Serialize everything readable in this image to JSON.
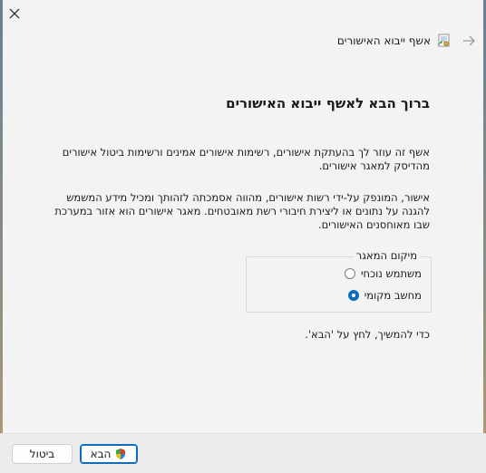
{
  "window": {
    "title": "אשף ייבוא האישורים"
  },
  "page": {
    "heading": "ברוך הבא לאשף ייבוא האישורים",
    "paragraph1": "אשף זה עוזר לך בהעתקת אישורים, רשימות אישורים אמינים ורשימות ביטול אישורים מהדיסק למאגר אישורים.",
    "paragraph2": "אישור, המונפק על-ידי רשות אישורים, מהווה אסמכתה לזהותך ומכיל מידע המשמש להגנה על נתונים או ליצירת חיבורי רשת מאובטחים. מאגר אישורים הוא אזור במערכת שבו מאוחסנים האישורים.",
    "store_location": {
      "legend": "מיקום המאגר",
      "options": [
        {
          "label": "משתמש נוכחי",
          "selected": false
        },
        {
          "label": "מחשב מקומי",
          "selected": true
        }
      ]
    },
    "continue_text": "כדי להמשיך, לחץ על 'הבא'."
  },
  "footer": {
    "next_label": "הבא",
    "cancel_label": "ביטול"
  },
  "colors": {
    "accent": "#0f6cbd",
    "background": "#f3f3f3"
  },
  "icons": {
    "close": "close-icon",
    "back": "back-arrow-icon",
    "wizard": "certificate-wizard-icon",
    "uac": "uac-shield-icon"
  }
}
